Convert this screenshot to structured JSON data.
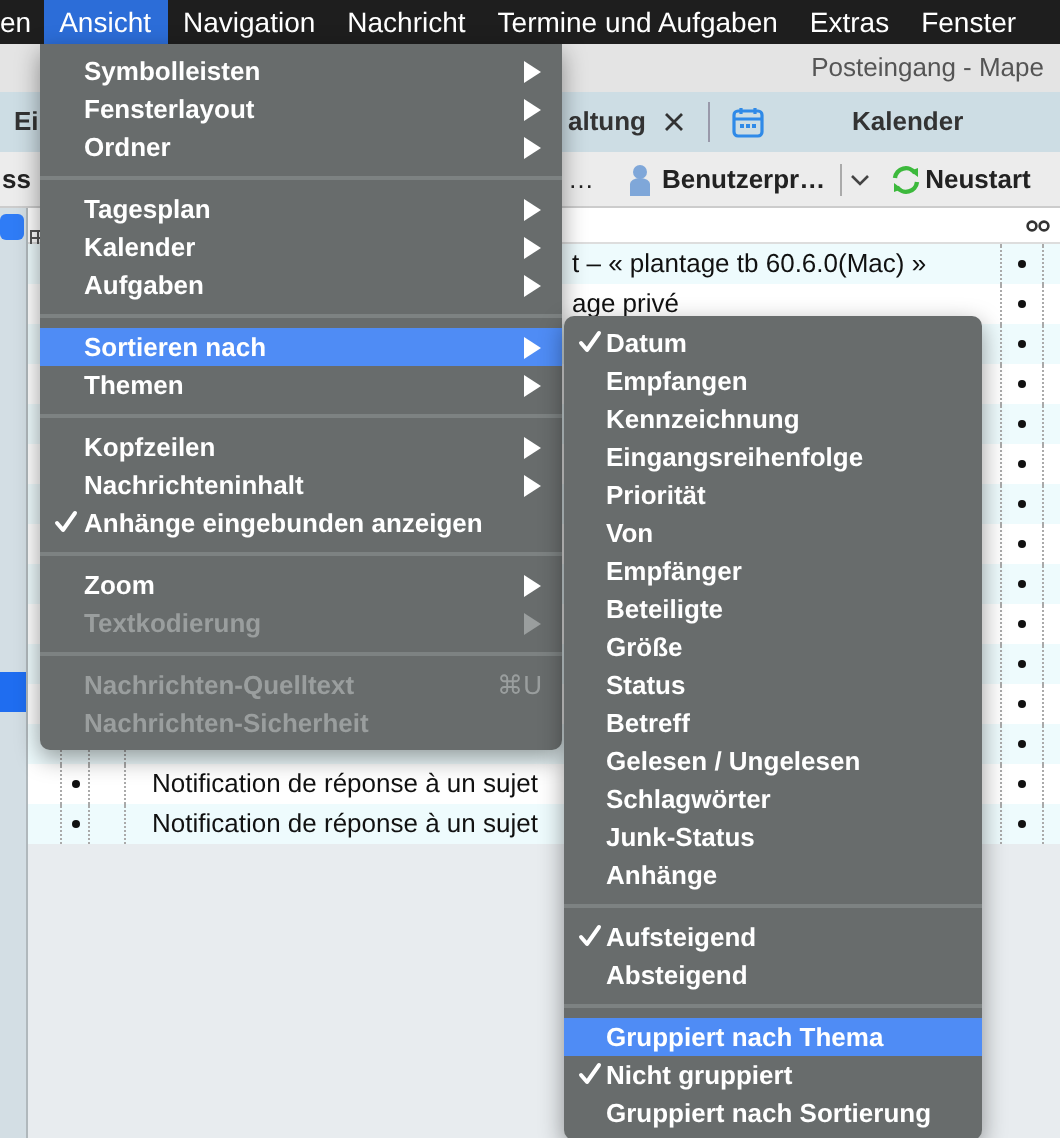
{
  "menubar": [
    {
      "label": "en",
      "selected": false
    },
    {
      "label": "Ansicht",
      "selected": true
    },
    {
      "label": "Navigation",
      "selected": false
    },
    {
      "label": "Nachricht",
      "selected": false
    },
    {
      "label": "Termine und Aufgaben",
      "selected": false
    },
    {
      "label": "Extras",
      "selected": false
    },
    {
      "label": "Fenster",
      "selected": false
    }
  ],
  "window": {
    "title": "Posteingang - Mape"
  },
  "tabs": [
    {
      "label": "Ei",
      "kind": "plain"
    },
    {
      "label": "altung",
      "kind": "closable"
    },
    {
      "label": "Kalender",
      "kind": "calendar"
    }
  ],
  "toolbar": [
    {
      "label": "ss",
      "kind": "plain"
    },
    {
      "label": "…",
      "kind": "plain"
    },
    {
      "label": "Benutzerpr…",
      "kind": "profile"
    },
    {
      "label": "Neustart",
      "kind": "restart"
    }
  ],
  "messages": [
    {
      "subject": "t – « plantage tb 60.6.0(Mac) »",
      "selected": false
    },
    {
      "subject": "age privé",
      "selected": false
    },
    {
      "selected": false
    },
    {
      "selected": false
    },
    {
      "selected": false
    },
    {
      "selected": false
    },
    {
      "selected": false
    },
    {
      "selected": false
    },
    {
      "selected": false
    },
    {
      "selected": false
    },
    {
      "selected": false
    },
    {
      "selected": false
    },
    {
      "selected": false
    },
    {
      "subject": "Notification de réponse à un sujet",
      "selected": false
    },
    {
      "subject": "Notification de réponse à un sujet",
      "selected": false
    }
  ],
  "view_menu": [
    {
      "kind": "item",
      "label": "Symbolleisten",
      "submenu": true,
      "selected": false,
      "disabled": false
    },
    {
      "kind": "item",
      "label": "Fensterlayout",
      "submenu": true,
      "selected": false,
      "disabled": false
    },
    {
      "kind": "item",
      "label": "Ordner",
      "submenu": true,
      "selected": false,
      "disabled": false
    },
    {
      "kind": "separator"
    },
    {
      "kind": "item",
      "label": "Tagesplan",
      "submenu": true,
      "selected": false,
      "disabled": false
    },
    {
      "kind": "item",
      "label": "Kalender",
      "submenu": true,
      "selected": false,
      "disabled": false
    },
    {
      "kind": "item",
      "label": "Aufgaben",
      "submenu": true,
      "selected": false,
      "disabled": false
    },
    {
      "kind": "separator"
    },
    {
      "kind": "item",
      "label": "Sortieren nach",
      "submenu": true,
      "selected": true,
      "disabled": false
    },
    {
      "kind": "item",
      "label": "Themen",
      "submenu": true,
      "selected": false,
      "disabled": false
    },
    {
      "kind": "separator"
    },
    {
      "kind": "item",
      "label": "Kopfzeilen",
      "submenu": true,
      "selected": false,
      "disabled": false
    },
    {
      "kind": "item",
      "label": "Nachrichteninhalt",
      "submenu": true,
      "selected": false,
      "disabled": false
    },
    {
      "kind": "item",
      "label": "Anhänge eingebunden anzeigen",
      "checked": true,
      "selected": false,
      "disabled": false
    },
    {
      "kind": "separator"
    },
    {
      "kind": "item",
      "label": "Zoom",
      "submenu": true,
      "selected": false,
      "disabled": false
    },
    {
      "kind": "item",
      "label": "Textkodierung",
      "submenu": true,
      "selected": false,
      "disabled": true
    },
    {
      "kind": "separator"
    },
    {
      "kind": "item",
      "label": "Nachrichten-Quelltext",
      "shortcut": "⌘U",
      "selected": false,
      "disabled": true
    },
    {
      "kind": "item",
      "label": "Nachrichten-Sicherheit",
      "selected": false,
      "disabled": true
    }
  ],
  "sort_menu": [
    {
      "kind": "item",
      "label": "Datum",
      "checked": true,
      "selected": false
    },
    {
      "kind": "item",
      "label": "Empfangen",
      "checked": false,
      "selected": false
    },
    {
      "kind": "item",
      "label": "Kennzeichnung",
      "checked": false,
      "selected": false
    },
    {
      "kind": "item",
      "label": "Eingangsreihenfolge",
      "checked": false,
      "selected": false
    },
    {
      "kind": "item",
      "label": "Priorität",
      "checked": false,
      "selected": false
    },
    {
      "kind": "item",
      "label": "Von",
      "checked": false,
      "selected": false
    },
    {
      "kind": "item",
      "label": "Empfänger",
      "checked": false,
      "selected": false
    },
    {
      "kind": "item",
      "label": "Beteiligte",
      "checked": false,
      "selected": false
    },
    {
      "kind": "item",
      "label": "Größe",
      "checked": false,
      "selected": false
    },
    {
      "kind": "item",
      "label": "Status",
      "checked": false,
      "selected": false
    },
    {
      "kind": "item",
      "label": "Betreff",
      "checked": false,
      "selected": false
    },
    {
      "kind": "item",
      "label": "Gelesen / Ungelesen",
      "checked": false,
      "selected": false
    },
    {
      "kind": "item",
      "label": "Schlagwörter",
      "checked": false,
      "selected": false
    },
    {
      "kind": "item",
      "label": "Junk-Status",
      "checked": false,
      "selected": false
    },
    {
      "kind": "item",
      "label": "Anhänge",
      "checked": false,
      "selected": false
    },
    {
      "kind": "separator"
    },
    {
      "kind": "item",
      "label": "Aufsteigend",
      "checked": true,
      "selected": false
    },
    {
      "kind": "item",
      "label": "Absteigend",
      "checked": false,
      "selected": false
    },
    {
      "kind": "separator"
    },
    {
      "kind": "item",
      "label": "Gruppiert nach Thema",
      "checked": false,
      "selected": true
    },
    {
      "kind": "item",
      "label": "Nicht gruppiert",
      "checked": true,
      "selected": false
    },
    {
      "kind": "item",
      "label": "Gruppiert nach Sortierung",
      "checked": false,
      "selected": false
    }
  ]
}
